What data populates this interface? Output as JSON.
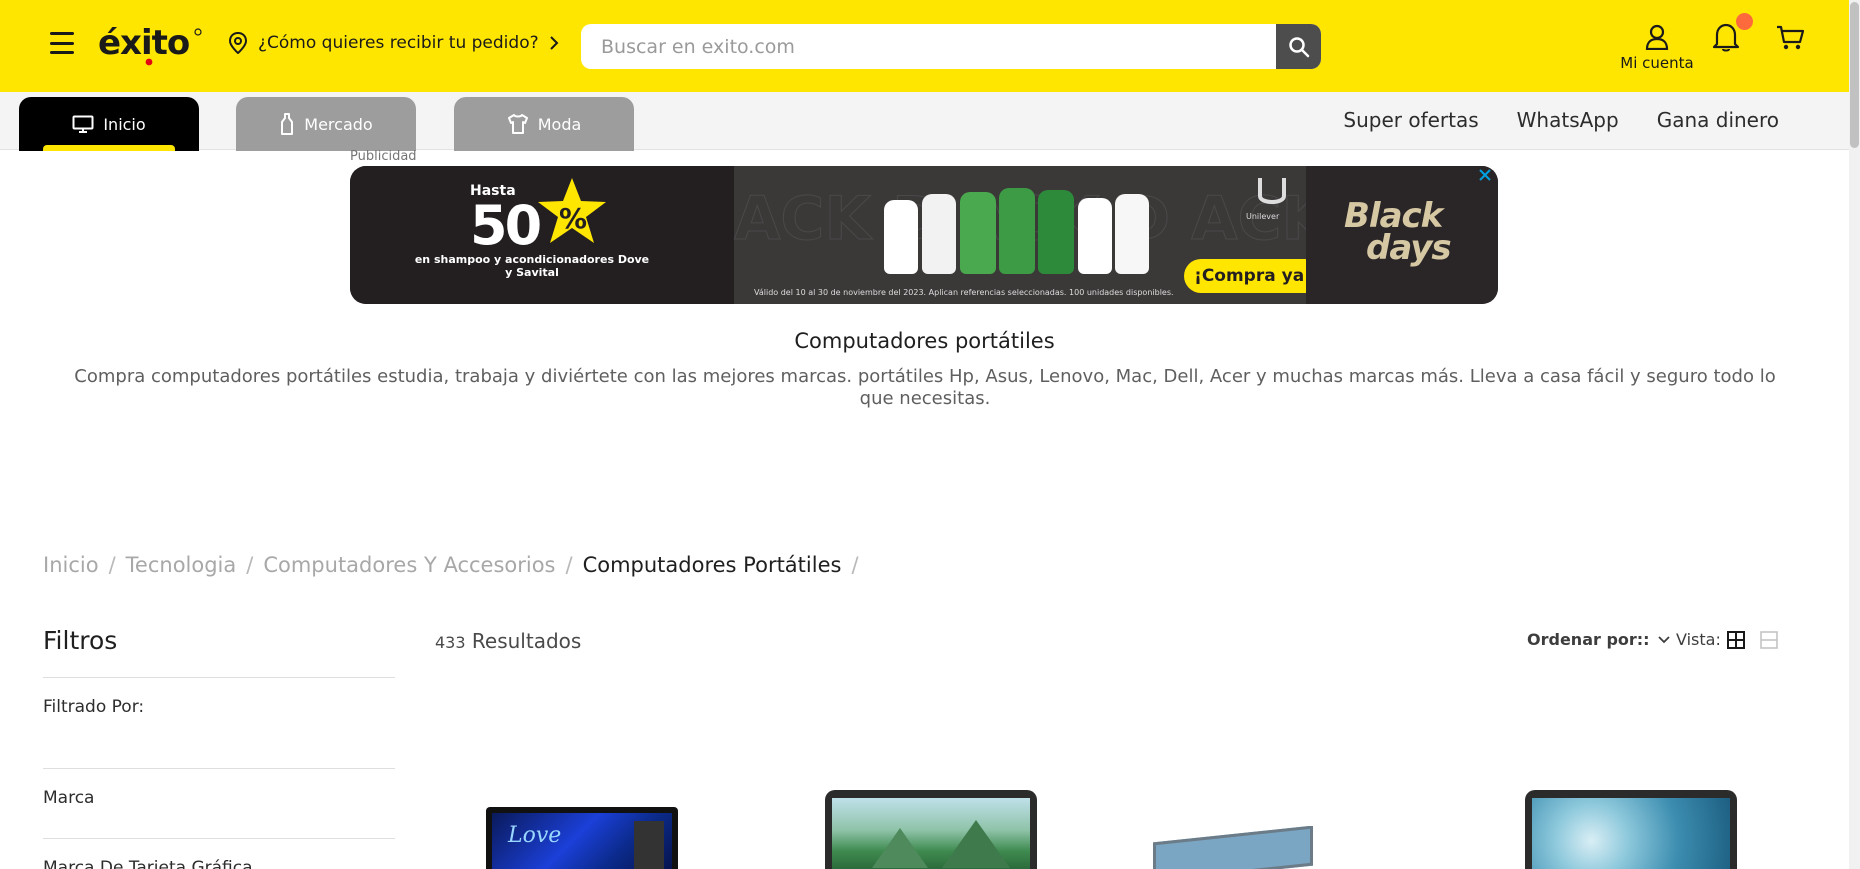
{
  "header": {
    "logo_text": "éxito",
    "delivery_prompt": "¿Cómo quieres recibir tu pedido?",
    "search_placeholder": "Buscar en exito.com",
    "account_label": "Mi cuenta"
  },
  "nav": {
    "tabs": [
      {
        "label": "Inicio",
        "icon": "monitor-icon",
        "active": true
      },
      {
        "label": "Mercado",
        "icon": "bottle-icon",
        "active": false
      },
      {
        "label": "Moda",
        "icon": "shirt-icon",
        "active": false
      }
    ],
    "links": [
      "Super ofertas",
      "WhatsApp",
      "Gana dinero"
    ]
  },
  "ad": {
    "label": "Publicidad",
    "hasta": "Hasta",
    "discount": "50",
    "percent": "%",
    "text": "en shampoo y acondicionadores Dove y Savital",
    "legal": "Válido del 10 al 30 de noviembre del 2023. Aplican referencias seleccionadas. 100 unidades disponibles.",
    "cta": "¡Compra ya!",
    "brand": "Unilever",
    "campaign_line1": "Black",
    "campaign_line2": "days"
  },
  "category": {
    "title": "Computadores portátiles",
    "description": "Compra computadores portátiles estudia, trabaja y diviértete con las mejores marcas. portátiles Hp, Asus, Lenovo, Mac, Dell, Acer y muchas marcas más. Lleva a casa fácil y seguro todo lo que necesitas."
  },
  "breadcrumb": [
    "Inicio",
    "Tecnologia",
    "Computadores Y Accesorios",
    "Computadores Portátiles"
  ],
  "filters": {
    "title": "Filtros",
    "filtered_by": "Filtrado Por:",
    "items": [
      "Marca",
      "Marca De Tarjeta Gráfica"
    ]
  },
  "results": {
    "count": "433",
    "label": "Resultados",
    "sort_label": "Ordenar por::",
    "view_label": "Vista:"
  },
  "colors": {
    "brand_yellow": "#ffe600",
    "tab_active": "#000000",
    "tab_inactive": "#9d9d9d",
    "notification": "#ff6a3d"
  }
}
